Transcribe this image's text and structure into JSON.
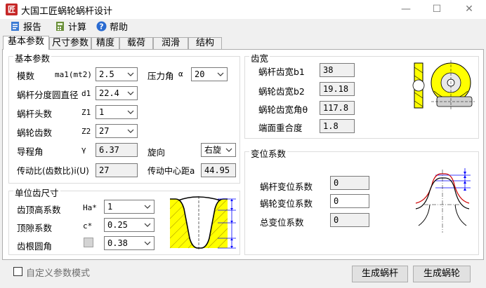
{
  "window": {
    "title": "大国工匠蜗轮蜗杆设计",
    "app_icon": "匠"
  },
  "menu": {
    "report": "报告",
    "calc": "计算",
    "help": "帮助"
  },
  "tabs": [
    "基本参数",
    "尺寸参数",
    "精度",
    "载荷",
    "润滑",
    "结构"
  ],
  "basic": {
    "title": "基本参数",
    "module": {
      "label": "模数",
      "sym": "ma1(mt2)",
      "value": "2.5"
    },
    "pressure_angle": {
      "label": "压力角",
      "sym": "α",
      "value": "20"
    },
    "pitch_ratio": {
      "label": "蜗杆分度圆直径",
      "sym": "d1",
      "value": "22.4"
    },
    "z1": {
      "label": "蜗杆头数",
      "sym": "Z1",
      "value": "1"
    },
    "z2": {
      "label": "蜗轮齿数",
      "sym": "Z2",
      "value": "27"
    },
    "lead_angle": {
      "label": "导程角",
      "sym": "γ",
      "value": "6.37"
    },
    "hand": {
      "label": "旋向",
      "value": "右旋"
    },
    "ratio": {
      "label": "传动比(齿数比)i(U)",
      "value": "27"
    },
    "center": {
      "label": "传动中心距a",
      "value": "44.95"
    }
  },
  "unit_tooth": {
    "title": "单位齿尺寸",
    "ha": {
      "label": "齿顶高系数",
      "sym": "Ha*",
      "value": "1"
    },
    "c": {
      "label": "顶隙系数",
      "sym": "c*",
      "value": "0.25"
    },
    "rf": {
      "label": "齿根圆角",
      "value": "0.38"
    }
  },
  "width": {
    "title": "齿宽",
    "b1": {
      "label": "蜗杆齿宽b1",
      "value": "38"
    },
    "b2": {
      "label": "蜗轮齿宽b2",
      "value": "19.18"
    },
    "theta": {
      "label": "蜗轮齿宽角θ",
      "value": "117.8"
    },
    "overlap": {
      "label": "端面重合度",
      "value": "1.8"
    }
  },
  "shift": {
    "title": "变位系数",
    "worm": {
      "label": "蜗杆变位系数",
      "value": "0"
    },
    "wheel": {
      "label": "蜗轮变位系数",
      "value": "0"
    },
    "total": {
      "label": "总变位系数",
      "value": "0"
    }
  },
  "footer": {
    "custom_mode": "自定义参数模式",
    "gen_worm": "生成蜗杆",
    "gen_wheel": "生成蜗轮"
  },
  "colors": {
    "accent_yellow": "#ffff00",
    "dim_blue": "#0000ff",
    "profile_red": "#cc0000"
  }
}
